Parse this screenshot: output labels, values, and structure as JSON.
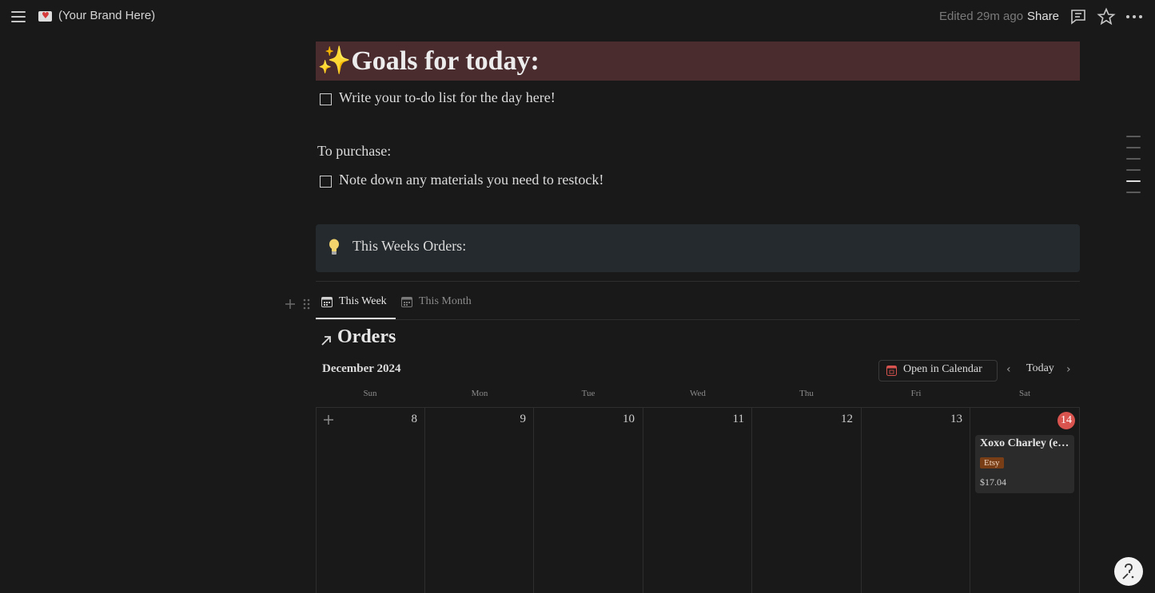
{
  "topbar": {
    "brand": "(Your Brand Here)",
    "edited": "Edited 29m ago",
    "share": "Share"
  },
  "goals": {
    "title": "✨Goals for today:",
    "todo": "Write your to-do list for the day here!"
  },
  "purchase": {
    "label": "To purchase:",
    "todo": "Note down any materials you need to restock!"
  },
  "callout": {
    "icon": "lightbulb-icon",
    "text": "This Weeks Orders:"
  },
  "tabs": [
    {
      "label": "This Week",
      "active": true
    },
    {
      "label": "This Month",
      "active": false
    }
  ],
  "database": {
    "title": "Orders",
    "month": "December 2024",
    "open_calendar": "Open in Calendar",
    "today": "Today",
    "weekdays": [
      "Sun",
      "Mon",
      "Tue",
      "Wed",
      "Thu",
      "Fri",
      "Sat"
    ],
    "days": [
      "8",
      "9",
      "10",
      "11",
      "12",
      "13",
      "14"
    ],
    "today_index": 6
  },
  "event": {
    "title": "Xoxo Charley (e…",
    "tag": "Etsy",
    "price": "$17.04"
  },
  "colors": {
    "background": "#191919",
    "goals_banner": "#4a2b2e",
    "callout": "#252a2e",
    "today_badge": "#d9534f",
    "etsy_tag": "#7a3e16"
  }
}
